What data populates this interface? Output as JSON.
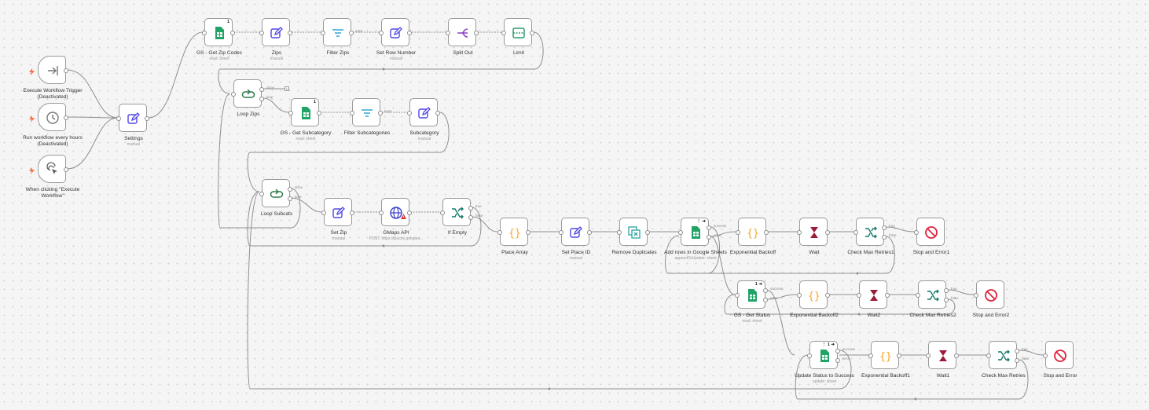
{
  "colors": {
    "wire": "#8f8f8f",
    "edit_icon": "#4f46e5",
    "sheets_icon": "#21a366",
    "filter_icon": "#31a6db",
    "splitout_icon": "#8f40c9",
    "limit_icon": "#2e9c6a",
    "loop_icon": "#2b7a4b",
    "if_icon": "#137a6a",
    "code_icon": "#f5a623",
    "wait_icon": "#9b1c37",
    "stop_icon": "#e0213c",
    "globe_icon": "#3a40cc",
    "trigger_bolt": "#ff6d3a",
    "warning": "#dd3a3a"
  },
  "nodes": {
    "execute_workflow_trigger": {
      "label": "Execute Workflow Trigger",
      "status": "(Deactivated)",
      "icon": "execute-arrow-icon"
    },
    "run_every_hours": {
      "label": "Run workflow every hours",
      "status": "(Deactivated)",
      "icon": "clock-icon"
    },
    "manual_trigger": {
      "label": "When clicking \"Execute Workflow\"",
      "icon": "cursor-click-icon"
    },
    "settings": {
      "label": "Settings",
      "sub": "manual"
    },
    "gs_get_zip_codes": {
      "label": "GS - Get Zip Codes",
      "sub": "read: sheet",
      "badge": "1"
    },
    "zips": {
      "label": "Zips",
      "sub": "manual"
    },
    "filter_zips": {
      "label": "Filter Zips"
    },
    "set_row_number": {
      "label": "Set Row Number",
      "sub": "manual"
    },
    "split_out": {
      "label": "Split Out"
    },
    "limit": {
      "label": "Limit"
    },
    "loop_zips": {
      "label": "Loop Zips"
    },
    "gs_get_subcategory": {
      "label": "GS - Get Subcategory",
      "sub": "read: sheet",
      "badge": "1"
    },
    "filter_subcategories": {
      "label": "Filter Subcategories"
    },
    "subcategory": {
      "label": "Subcategory",
      "sub": "manual"
    },
    "loop_subcats": {
      "label": "Loop Subcats"
    },
    "set_zip": {
      "label": "Set Zip",
      "sub": "manual"
    },
    "gmaps_api": {
      "label": "GMaps API",
      "sub": "POST: https://places.googlea..."
    },
    "if_empty": {
      "label": "If Empty"
    },
    "place_array": {
      "label": "Place Array"
    },
    "set_place_id": {
      "label": "Set Place ID",
      "sub": "manual"
    },
    "remove_duplicates": {
      "label": "Remove Duplicates"
    },
    "add_rows_google_sheets": {
      "label": "Add rows in Google Sheets",
      "sub": "appendOrUpdate: sheet",
      "badge": "⋮ ➜"
    },
    "exponential_backoff": {
      "label": "Exponential Backoff"
    },
    "wait": {
      "label": "Wait"
    },
    "check_max_retries1": {
      "label": "Check Max Retries1"
    },
    "stop_and_error1": {
      "label": "Stop and Error1"
    },
    "gs_get_status": {
      "label": "GS - Get Status",
      "sub": "read: sheet",
      "badge": "1 ➜"
    },
    "exponential_backoff2": {
      "label": "Exponential Backoff2"
    },
    "wait2": {
      "label": "Wait2"
    },
    "check_max_retries2": {
      "label": "Check Max Retries2"
    },
    "stop_and_error2": {
      "label": "Stop and Error2"
    },
    "update_status_success": {
      "label": "Update Status to Success",
      "sub": "update: sheet",
      "badge": "⋮ 1 ➜"
    },
    "exponential_backoff1": {
      "label": "Exponential Backoff1"
    },
    "wait1": {
      "label": "Wait1"
    },
    "check_max_retries": {
      "label": "Check Max Retries"
    },
    "stop_and_error": {
      "label": "Stop and Error"
    }
  },
  "port_labels": {
    "done": "done",
    "loop": "loop",
    "kept": "Kept",
    "true": "true",
    "false": "false",
    "success": "success",
    "error": "error"
  }
}
